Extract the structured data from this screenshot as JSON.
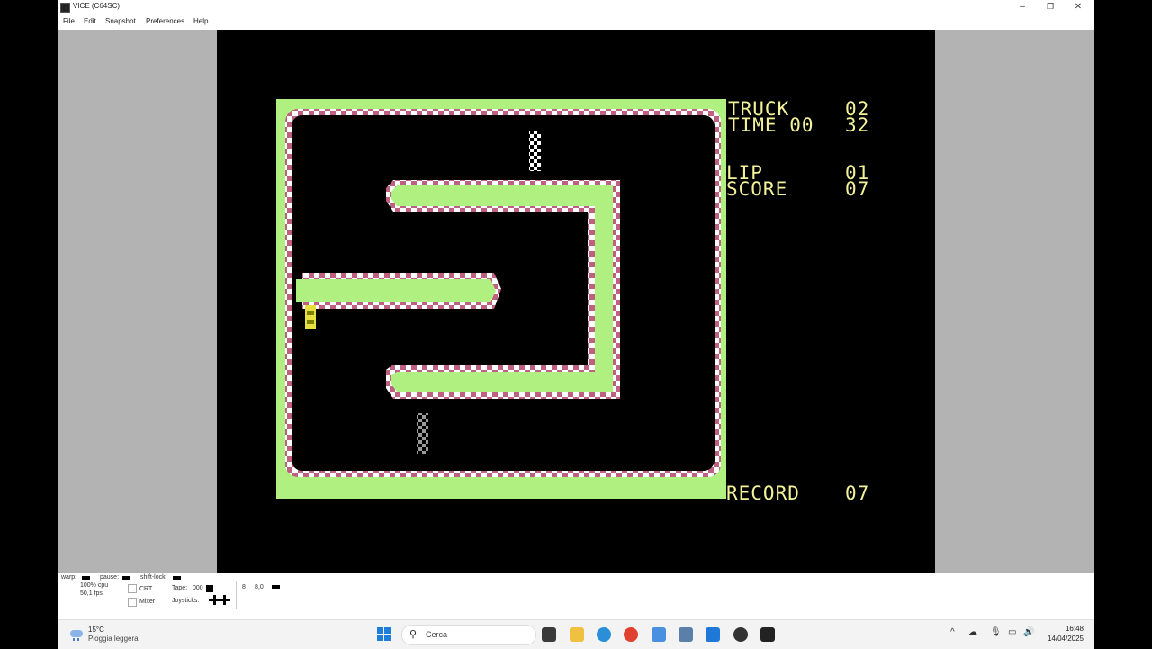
{
  "window": {
    "title": "VICE (C64SC)",
    "minimize": "–",
    "maximize": "❐",
    "close": "✕"
  },
  "menu": [
    "File",
    "Edit",
    "Snapshot",
    "Preferences",
    "Help"
  ],
  "game": {
    "track_label": "TRUCK",
    "track_value": "02",
    "time_label": "TIME 00",
    "time_value": "32",
    "lap_label": "LIP",
    "lap_value": "01",
    "score_label": "SCORE",
    "score_value": "07",
    "record_label": "RECORD",
    "record_value": "07"
  },
  "status": {
    "warp": "warp:",
    "pause": "pause:",
    "shift_lock": "shift-lock:",
    "cpu": "100% cpu",
    "fps": "50,1 fps",
    "crt": "CRT",
    "mixer": "Mixer",
    "tape": "Tape:",
    "tape_counter": "000",
    "joysticks": "Joysticks:",
    "drive_num": "8",
    "drive_track": "8,0"
  },
  "taskbar": {
    "weather_temp": "15°C",
    "weather_desc": "Pioggia leggera",
    "search_placeholder": "Cerca",
    "time": "16:48",
    "date": "14/04/2025"
  },
  "colors": {
    "grass": "#b0f080",
    "curb_red": "#c06080",
    "hud_yellow": "#f2f29a",
    "car": "#e8e040"
  }
}
